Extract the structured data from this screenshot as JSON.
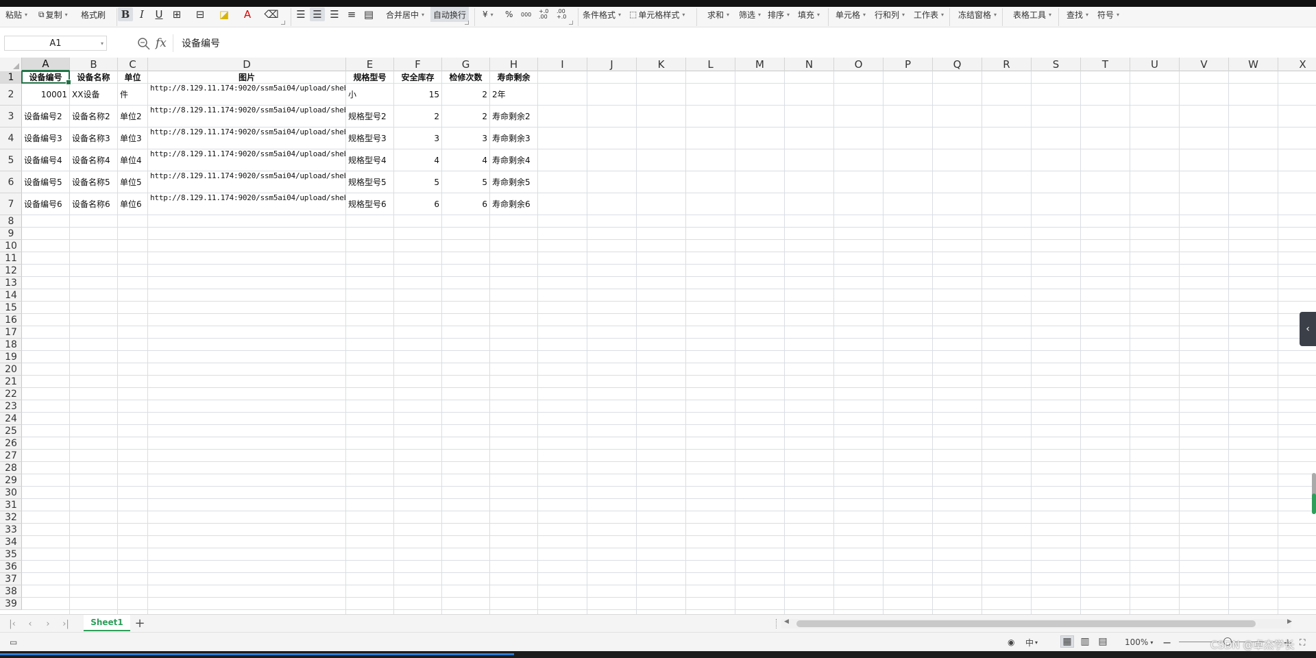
{
  "toolbar": {
    "paste": "粘贴",
    "copy": "复制",
    "format_painter": "格式刷",
    "bold": "B",
    "italic": "I",
    "underline": "U",
    "merge_center": "合并居中",
    "wrap_text": "自动换行",
    "currency": "¥",
    "percent": "%",
    "thousands": "000",
    "inc_decimal": "+.0 .00",
    "dec_decimal": ".00 +.0",
    "conditional_format": "条件格式",
    "cell_style": "单元格样式",
    "sum": "求和",
    "filter": "筛选",
    "sort": "排序",
    "fill": "填充",
    "cell": "单元格",
    "row_col": "行和列",
    "worksheet": "工作表",
    "freeze": "冻结窗格",
    "table_tools": "表格工具",
    "find": "查找",
    "symbol": "符号"
  },
  "formula_bar": {
    "name_box": "A1",
    "fx": "fx",
    "content": "设备编号"
  },
  "columns": [
    "A",
    "B",
    "C",
    "D",
    "E",
    "F",
    "G",
    "H",
    "I",
    "J",
    "K",
    "L",
    "M",
    "N",
    "O",
    "P",
    "Q",
    "R",
    "S",
    "T",
    "U",
    "V",
    "W",
    "X"
  ],
  "rows": [
    "1",
    "2",
    "3",
    "4",
    "5",
    "6",
    "7",
    "8",
    "9",
    "10",
    "11",
    "12",
    "13",
    "14",
    "15",
    "16",
    "17",
    "18",
    "19",
    "20",
    "21",
    "22",
    "23",
    "24",
    "25",
    "26",
    "27",
    "28",
    "29",
    "30",
    "31",
    "32",
    "33",
    "34",
    "35",
    "36",
    "37",
    "38",
    "39"
  ],
  "table": {
    "headers": [
      "设备编号",
      "设备名称",
      "单位",
      "图片",
      "规格型号",
      "安全库存",
      "检修次数",
      "寿命剩余"
    ],
    "rows": [
      [
        "10001",
        "XX设备",
        "件",
        "http://8.129.11.174:9020/ssm5ai04/upload/shebeixinxi_tupian1.jpg",
        "小",
        "15",
        "2",
        "2年"
      ],
      [
        "设备编号2",
        "设备名称2",
        "单位2",
        "http://8.129.11.174:9020/ssm5ai04/upload/shebeixinxi_tupian2.jpg",
        "规格型号2",
        "2",
        "2",
        "寿命剩余2"
      ],
      [
        "设备编号3",
        "设备名称3",
        "单位3",
        "http://8.129.11.174:9020/ssm5ai04/upload/shebeixinxi_tupian3.jpg",
        "规格型号3",
        "3",
        "3",
        "寿命剩余3"
      ],
      [
        "设备编号4",
        "设备名称4",
        "单位4",
        "http://8.129.11.174:9020/ssm5ai04/upload/shebeixinxi_tupian4.jpg",
        "规格型号4",
        "4",
        "4",
        "寿命剩余4"
      ],
      [
        "设备编号5",
        "设备名称5",
        "单位5",
        "http://8.129.11.174:9020/ssm5ai04/upload/shebeixinxi_tupian5.jpg",
        "规格型号5",
        "5",
        "5",
        "寿命剩余5"
      ],
      [
        "设备编号6",
        "设备名称6",
        "单位6",
        "http://8.129.11.174:9020/ssm5ai04/upload/shebeixinxi_tupian6.jpg",
        "规格型号6",
        "6",
        "6",
        "寿命剩余6"
      ]
    ]
  },
  "sheet_tabs": {
    "active": "Sheet1",
    "add": "+"
  },
  "status_bar": {
    "zoom": "100%",
    "input_mode": "中"
  },
  "watermark": "CSDN @卓杰学长",
  "colors": {
    "accent": "#217346",
    "sheet_tab": "#2e9e5a",
    "grid": "#dadde2"
  }
}
